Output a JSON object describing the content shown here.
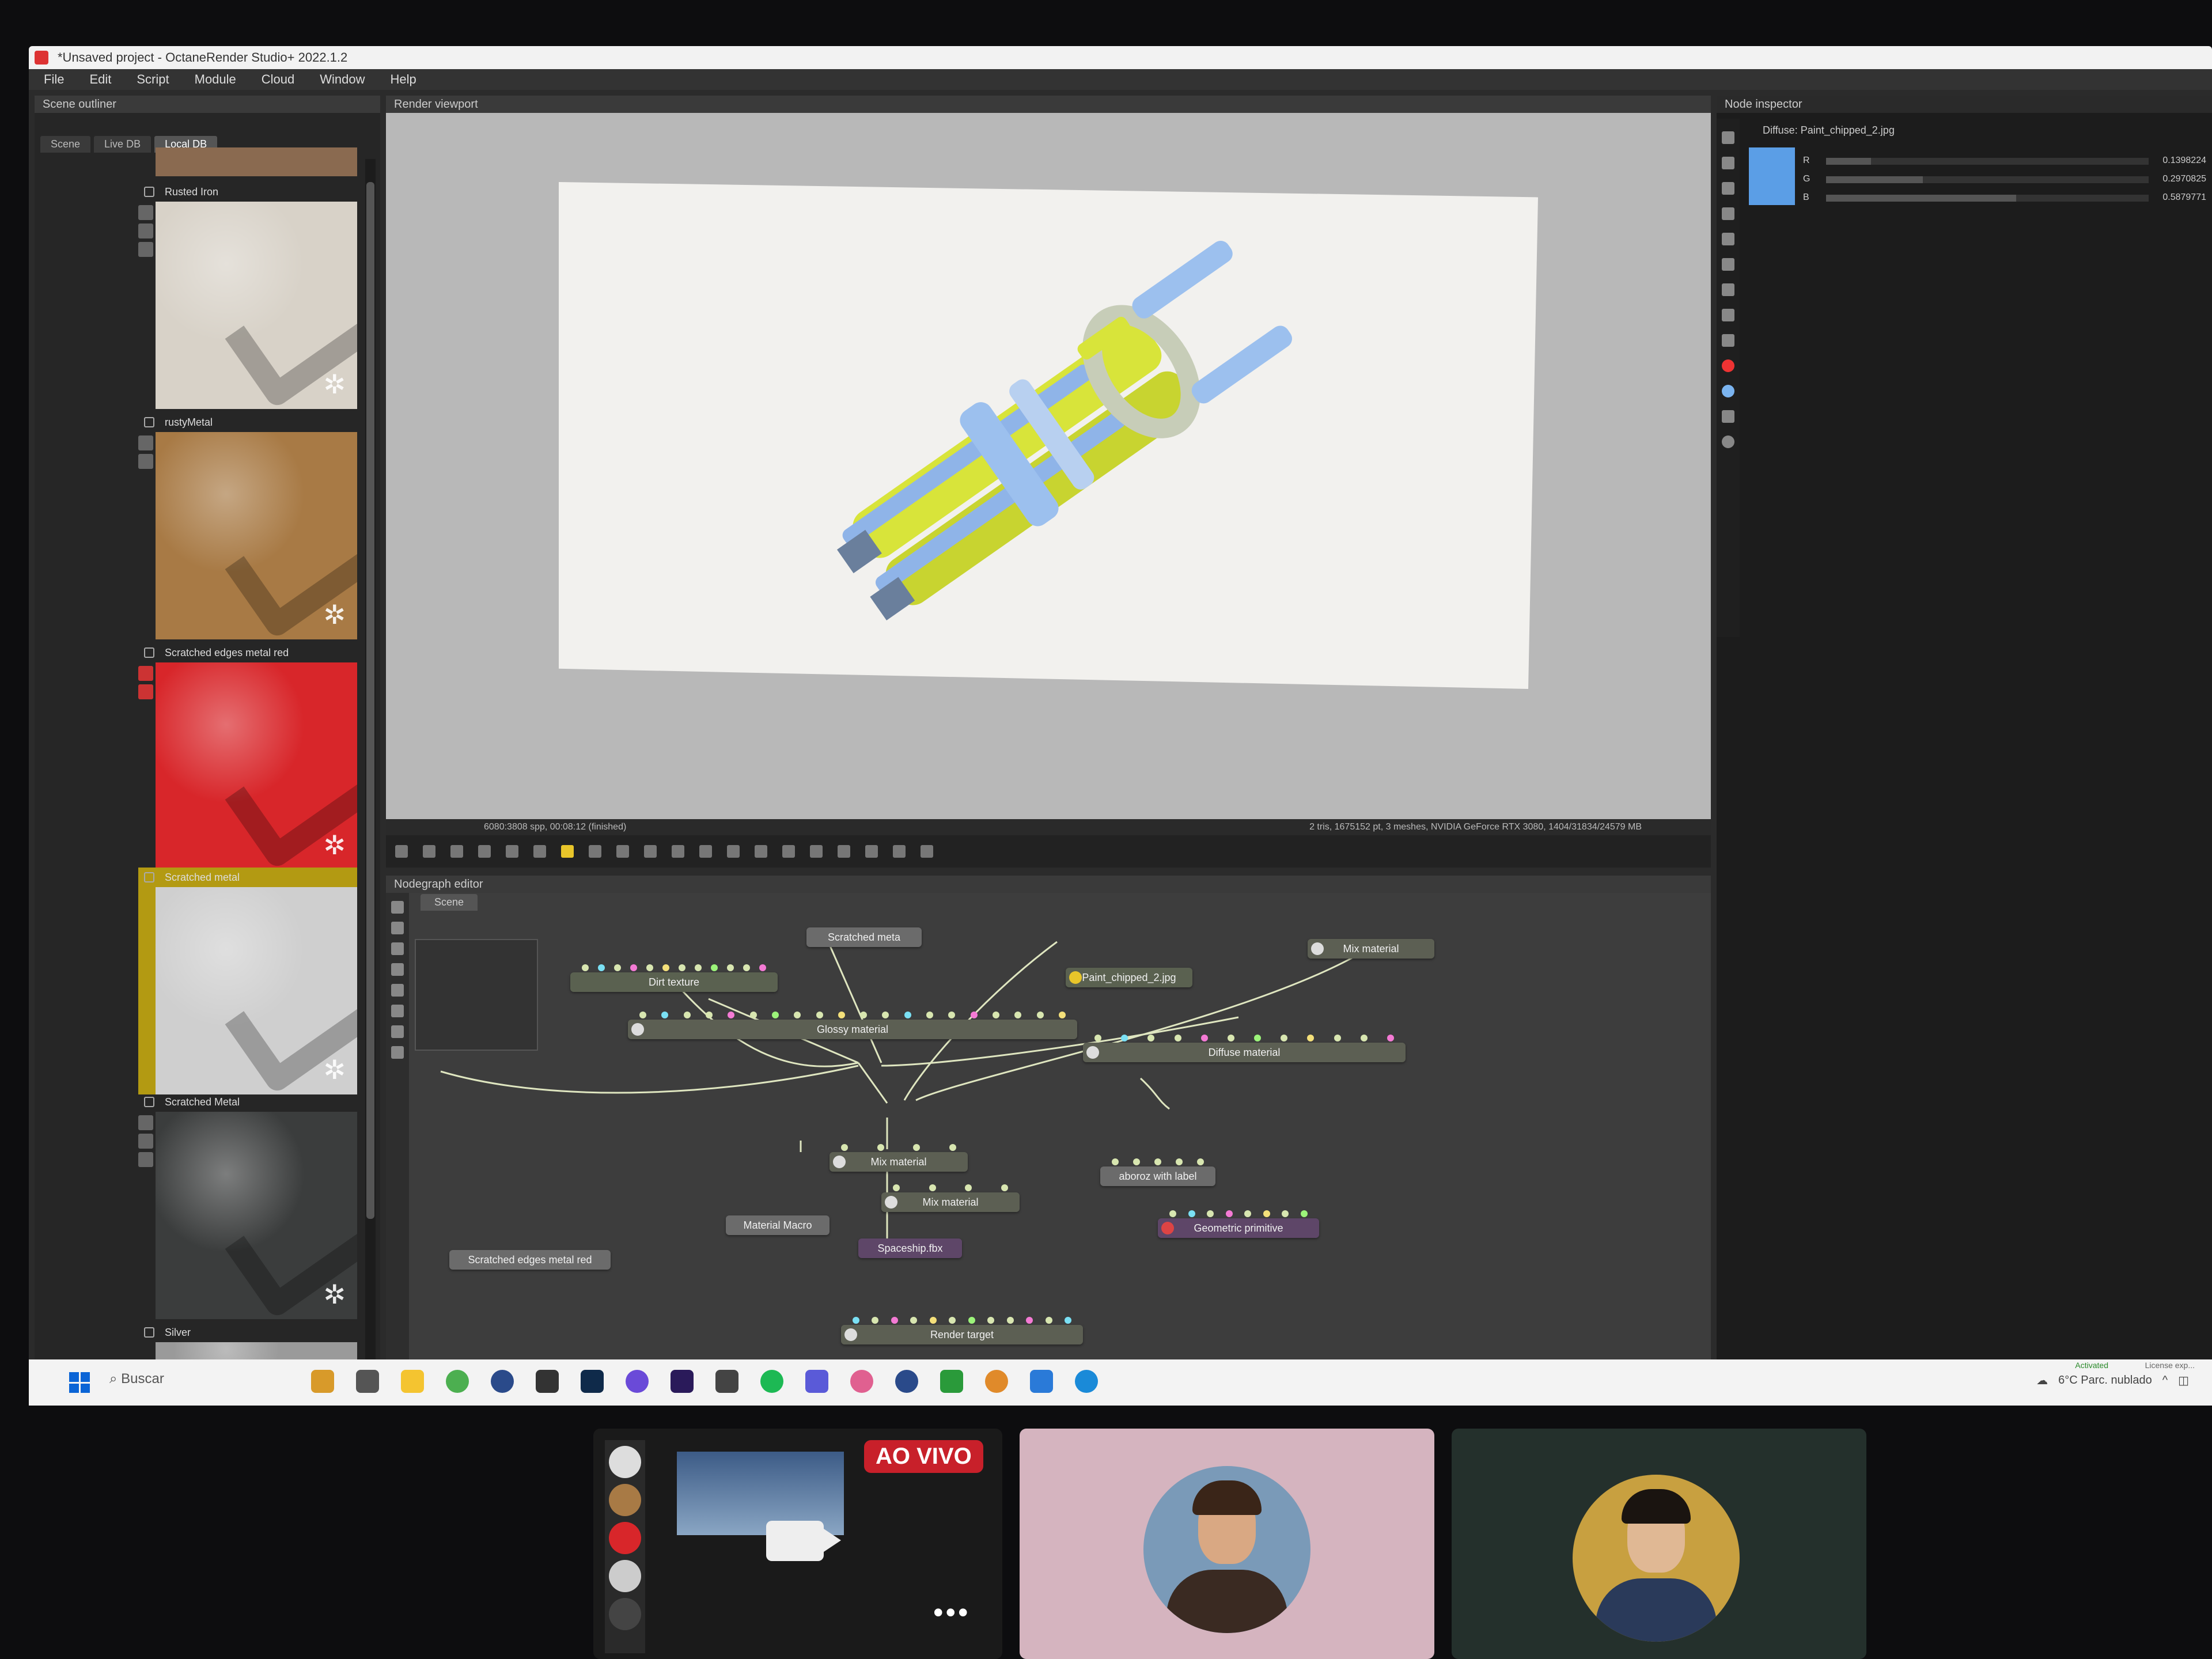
{
  "window": {
    "title": "*Unsaved project - OctaneRender Studio+ 2022.1.2"
  },
  "menu": [
    "File",
    "Edit",
    "Script",
    "Module",
    "Cloud",
    "Window",
    "Help"
  ],
  "outliner": {
    "title": "Scene outliner",
    "tabs": [
      "Scene",
      "Live DB",
      "Local DB"
    ],
    "materials": [
      {
        "label": "Rusted Iron",
        "color": "#d8d2c8"
      },
      {
        "label": "rustyMetal",
        "color": "#a87a45"
      },
      {
        "label": "Scratched edges metal red",
        "color": "#d8262a"
      },
      {
        "label": "Scratched metal",
        "color": "#cfcfcf"
      },
      {
        "label": "Scratched Metal",
        "color": "#3b3d3d"
      },
      {
        "label": "Silver",
        "color": "#9a9a9a"
      }
    ]
  },
  "viewport": {
    "title": "Render viewport",
    "status_left": "6080:3808 spp, 00:08:12 (finished)",
    "status_right": "2 tris, 1675152 pt, 3 meshes, NVIDIA GeForce RTX 3080, 1404/31834/24579 MB"
  },
  "nodegraph": {
    "title": "Nodegraph editor",
    "tab": "Scene",
    "nodes": {
      "scratched_metal": "Scratched meta",
      "dirt_texture": "Dirt texture",
      "paint_chipped": "Paint_chipped_2.jpg",
      "mix_material_top": "Mix material",
      "glossy_material": "Glossy material",
      "diffuse_material": "Diffuse material",
      "mix_material_1": "Mix material",
      "mix_material_2": "Mix material",
      "aboroz": "aboroz with label",
      "material_macro": "Material Macro",
      "spaceship": "Spaceship.fbx",
      "geometric_primitive": "Geometric primitive",
      "scratched_edges": "Scratched edges metal red",
      "render_target": "Render target"
    }
  },
  "inspector": {
    "title": "Node inspector",
    "header": "Diffuse: Paint_chipped_2.jpg",
    "swatch_color": "#5b9ee6",
    "channels": [
      {
        "label": "R",
        "value": "0.1398224",
        "level": 0.14
      },
      {
        "label": "G",
        "value": "0.2970825",
        "level": 0.3
      },
      {
        "label": "B",
        "value": "0.5879771",
        "level": 0.59
      }
    ]
  },
  "taskbar": {
    "search_placeholder": "Buscar",
    "weather": "6°C Parc. nublado",
    "activated": "Activated",
    "license": "License exp..."
  },
  "call": {
    "live_label": "AO VIVO",
    "more": "•••"
  }
}
